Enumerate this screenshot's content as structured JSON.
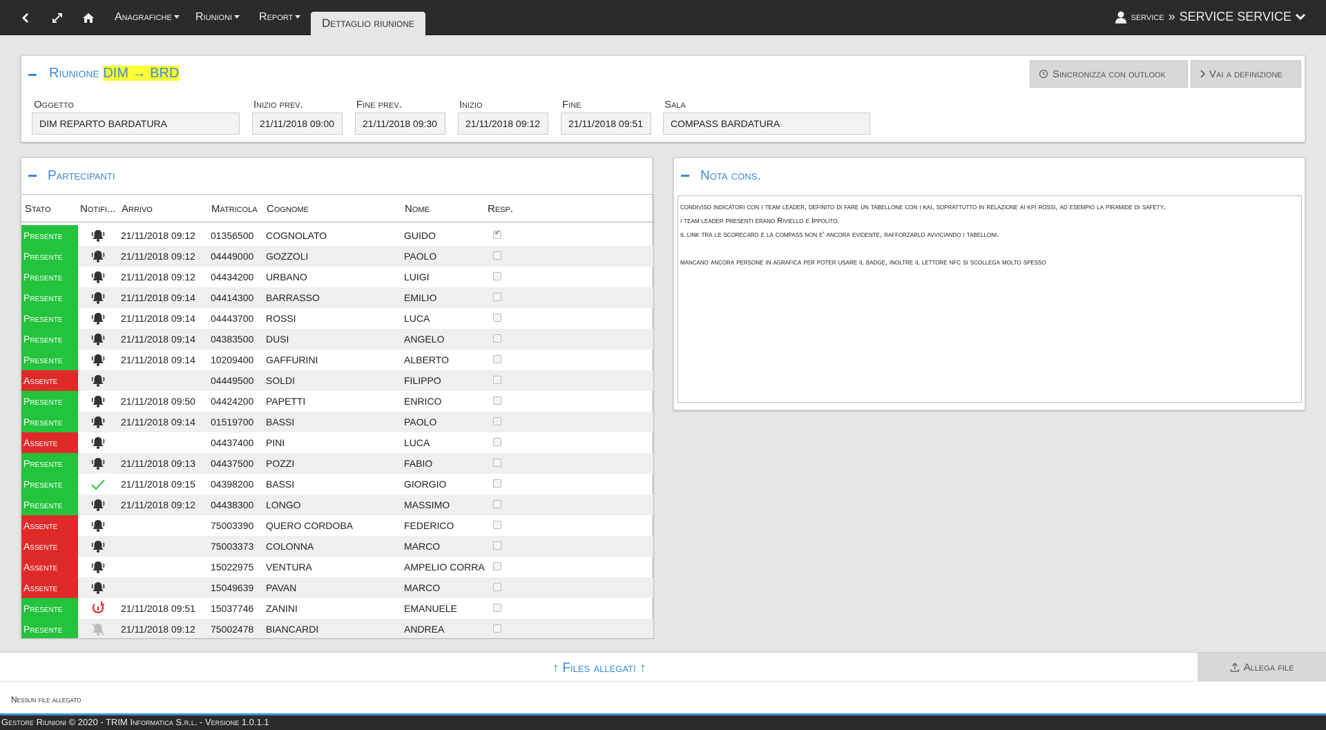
{
  "navbar": {
    "menus": [
      "Anagrafiche",
      "Riunioni",
      "Report"
    ],
    "active_tab": "Dettaglio riunione",
    "user_prefix": "service",
    "user_sep": "»",
    "user_name": "SERVICE SERVICE"
  },
  "meeting": {
    "title_prefix": "Riunione",
    "title_highlight": "DIM → BRD",
    "sync_label": "Sincronizza con outlook",
    "goto_label": "Vai a definizione",
    "fields": {
      "oggetto_label": "Oggetto",
      "oggetto": "DIM REPARTO BARDATURA",
      "inizio_prev_label": "Inizio prev.",
      "inizio_prev": "21/11/2018 09:00",
      "fine_prev_label": "Fine prev.",
      "fine_prev": "21/11/2018 09:30",
      "inizio_label": "Inizio",
      "inizio": "21/11/2018 09:12",
      "fine_label": "Fine",
      "fine": "21/11/2018 09:51",
      "sala_label": "Sala",
      "sala": "COMPASS BARDATURA"
    }
  },
  "participants": {
    "title": "Partecipanti",
    "columns": {
      "stato": "Stato",
      "notif": "Notifi...",
      "arrivo": "Arrivo",
      "matricola": "Matricola",
      "cognome": "Cognome",
      "nome": "Nome",
      "resp": "Resp."
    },
    "rows": [
      {
        "stato": "Presente",
        "notif": "bell",
        "arrivo": "21/11/2018 09:12",
        "matricola": "01356500",
        "cognome": "COGNOLATO",
        "nome": "GUIDO",
        "resp": true
      },
      {
        "stato": "Presente",
        "notif": "bell",
        "arrivo": "21/11/2018 09:12",
        "matricola": "04449000",
        "cognome": "GOZZOLI",
        "nome": "PAOLO",
        "resp": false
      },
      {
        "stato": "Presente",
        "notif": "bell",
        "arrivo": "21/11/2018 09:12",
        "matricola": "04434200",
        "cognome": "URBANO",
        "nome": "LUIGI",
        "resp": false
      },
      {
        "stato": "Presente",
        "notif": "bell",
        "arrivo": "21/11/2018 09:14",
        "matricola": "04414300",
        "cognome": "BARRASSO",
        "nome": "EMILIO",
        "resp": false
      },
      {
        "stato": "Presente",
        "notif": "bell",
        "arrivo": "21/11/2018 09:14",
        "matricola": "04443700",
        "cognome": "ROSSI",
        "nome": "LUCA",
        "resp": false
      },
      {
        "stato": "Presente",
        "notif": "bell",
        "arrivo": "21/11/2018 09:14",
        "matricola": "04383500",
        "cognome": "DUSI",
        "nome": "ANGELO",
        "resp": false
      },
      {
        "stato": "Presente",
        "notif": "bell",
        "arrivo": "21/11/2018 09:14",
        "matricola": "10209400",
        "cognome": "GAFFURINI",
        "nome": "ALBERTO",
        "resp": false
      },
      {
        "stato": "Assente",
        "notif": "bell",
        "arrivo": "",
        "matricola": "04449500",
        "cognome": "SOLDI",
        "nome": "FILIPPO",
        "resp": false
      },
      {
        "stato": "Presente",
        "notif": "bell",
        "arrivo": "21/11/2018 09:50",
        "matricola": "04424200",
        "cognome": "PAPETTI",
        "nome": "ENRICO",
        "resp": false
      },
      {
        "stato": "Presente",
        "notif": "bell",
        "arrivo": "21/11/2018 09:14",
        "matricola": "01519700",
        "cognome": "BASSI",
        "nome": "PAOLO",
        "resp": false
      },
      {
        "stato": "Assente",
        "notif": "bell",
        "arrivo": "",
        "matricola": "04437400",
        "cognome": "PINI",
        "nome": "LUCA",
        "resp": false
      },
      {
        "stato": "Presente",
        "notif": "bell",
        "arrivo": "21/11/2018 09:13",
        "matricola": "04437500",
        "cognome": "POZZI",
        "nome": "FABIO",
        "resp": false
      },
      {
        "stato": "Presente",
        "notif": "check",
        "arrivo": "21/11/2018 09:15",
        "matricola": "04398200",
        "cognome": "BASSI",
        "nome": "GIORGIO",
        "resp": false
      },
      {
        "stato": "Presente",
        "notif": "bell",
        "arrivo": "21/11/2018 09:12",
        "matricola": "04438300",
        "cognome": "LONGO",
        "nome": "MASSIMO",
        "resp": false
      },
      {
        "stato": "Assente",
        "notif": "bell",
        "arrivo": "",
        "matricola": "75003390",
        "cognome": "QUERO CORDOBA",
        "nome": "FEDERICO",
        "resp": false
      },
      {
        "stato": "Assente",
        "notif": "bell",
        "arrivo": "",
        "matricola": "75003373",
        "cognome": "COLONNA",
        "nome": "MARCO",
        "resp": false
      },
      {
        "stato": "Assente",
        "notif": "bell",
        "arrivo": "",
        "matricola": "15022975",
        "cognome": "VENTURA",
        "nome": "AMPELIO CORRADO",
        "resp": false
      },
      {
        "stato": "Assente",
        "notif": "bell",
        "arrivo": "",
        "matricola": "15049639",
        "cognome": "PAVAN",
        "nome": "MARCO",
        "resp": false
      },
      {
        "stato": "Presente",
        "notif": "retry",
        "arrivo": "21/11/2018 09:51",
        "matricola": "15037746",
        "cognome": "ZANINI",
        "nome": "EMANUELE",
        "resp": false
      },
      {
        "stato": "Presente",
        "notif": "bell-off",
        "arrivo": "21/11/2018 09:12",
        "matricola": "75002478",
        "cognome": "BIANCARDI",
        "nome": "ANDREA",
        "resp": false
      }
    ]
  },
  "notes": {
    "title": "Nota cons.",
    "lines": [
      "condiviso indicatori con i team leader, definito di fare un tabellone con i kai, soprattutto in relazione ai kpi rossi, ad esempio la piramide di safety.",
      "i team leader presenti erano Riviello e Ippolito.",
      "il link tra le scorecard e la compass non e' ancora evidente, rafforzarlo avviciando i tabelloni.",
      "",
      "mancano ancora persone in agrafica per poter usare il badge, inoltre il lettore nfc si scollega molto spesso"
    ]
  },
  "files": {
    "title": "↑ Files allegati ↑",
    "attach_label": "Allega file",
    "empty_text": "Nessun file allegato"
  },
  "footer": "Gestore Riunioni © 2020 - TRIM Informatica S.r.l. - Versione 1.0.1.1",
  "colors": {
    "presente": "#23c33c",
    "assente": "#e02a2a",
    "accent": "#3a8ad6",
    "highlight": "#ffff33"
  }
}
